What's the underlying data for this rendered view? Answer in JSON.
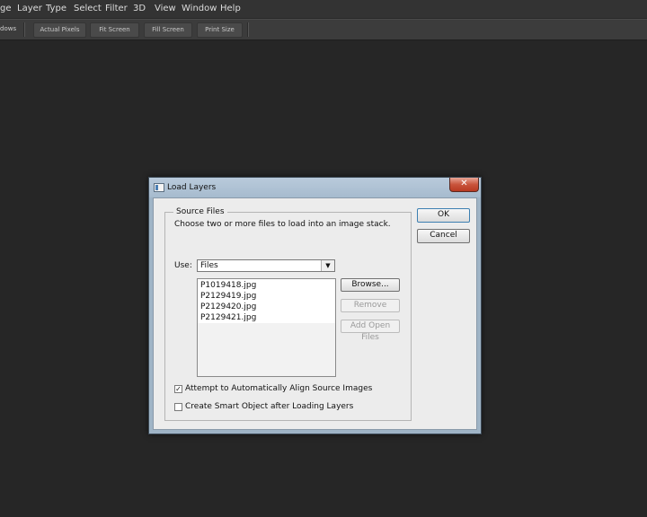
{
  "menubar": {
    "items": [
      "ge",
      "Layer",
      "Type",
      "Select",
      "Filter",
      "3D",
      "View",
      "Window",
      "Help"
    ]
  },
  "options_bar": {
    "windows_label": "dows",
    "buttons": [
      "Actual Pixels",
      "Fit Screen",
      "Fill Screen",
      "Print Size"
    ]
  },
  "dialog": {
    "title": "Load Layers",
    "close_glyph": "✕",
    "group_label": "Source Files",
    "instructions": "Choose two or more files to load into an image stack.",
    "use_label": "Use:",
    "use_value": "Files",
    "dropdown_glyph": "▼",
    "files": [
      "P1019418.jpg",
      "P2129419.jpg",
      "P2129420.jpg",
      "P2129421.jpg"
    ],
    "browse_label": "Browse...",
    "remove_label": "Remove",
    "add_open_files_label": "Add Open Files",
    "ok_label": "OK",
    "cancel_label": "Cancel",
    "align_label": "Attempt to Automatically Align Source Images",
    "align_checked": true,
    "smart_object_label": "Create Smart Object after Loading Layers",
    "smart_object_checked": false,
    "check_glyph": "✓"
  }
}
